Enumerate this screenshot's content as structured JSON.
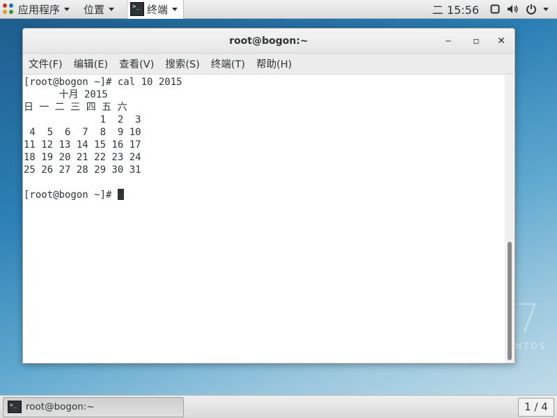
{
  "top_panel": {
    "apps_label": "应用程序",
    "places_label": "位置",
    "terminal_label": "终端",
    "clock": "二 15:56"
  },
  "window": {
    "title": "root@bogon:~",
    "controls": {
      "minimize": "‒",
      "maximize": "▫",
      "close": "✕"
    },
    "menu": [
      "文件(F)",
      "编辑(E)",
      "查看(V)",
      "搜索(S)",
      "终端(T)",
      "帮助(H)"
    ],
    "terminal_lines": [
      "[root@bogon ~]# cal 10 2015",
      "      十月 2015",
      "日 一 二 三 四 五 六",
      "             1  2  3",
      " 4  5  6  7  8  9 10",
      "11 12 13 14 15 16 17",
      "18 19 20 21 22 23 24",
      "25 26 27 28 29 30 31",
      "",
      "[root@bogon ~]# "
    ]
  },
  "desktop": {
    "watermark_number": "7",
    "watermark_text": "NTOS"
  },
  "bottom_panel": {
    "task_label": "root@bogon:~",
    "workspace": "1 / 4"
  },
  "icons": {
    "apps": "apps-menu-icon",
    "terminal": "terminal-icon",
    "screen": "screen-icon",
    "volume": "volume-icon",
    "power": "power-icon"
  }
}
